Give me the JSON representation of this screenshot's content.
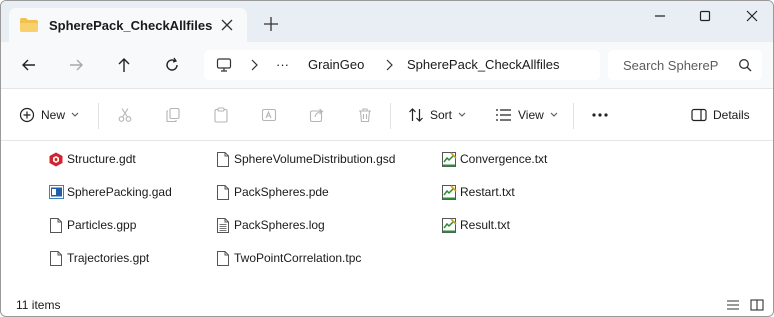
{
  "tab": {
    "title": "SpherePack_CheckAllfiles"
  },
  "address": {
    "crumbs": [
      "GrainGeo",
      "SpherePack_CheckAllfiles"
    ]
  },
  "search": {
    "placeholder": "Search SphereP"
  },
  "toolbar": {
    "new_label": "New",
    "sort_label": "Sort",
    "view_label": "View",
    "details_label": "Details"
  },
  "files": {
    "col1": [
      "Structure.gdt",
      "SpherePacking.gad",
      "Particles.gpp",
      "Trajectories.gpt"
    ],
    "col2": [
      "SphereVolumeDistribution.gsd",
      "PackSpheres.pde",
      "PackSpheres.log",
      "TwoPointCorrelation.tpc"
    ],
    "col3": [
      "Convergence.txt",
      "Restart.txt",
      "Result.txt"
    ]
  },
  "status": {
    "count": "11 items"
  },
  "colors": {
    "titlebar": "#e8eef4",
    "folder": "#f2c14e",
    "accent": "#0067c0",
    "gdt_icon": "#d1242f"
  }
}
